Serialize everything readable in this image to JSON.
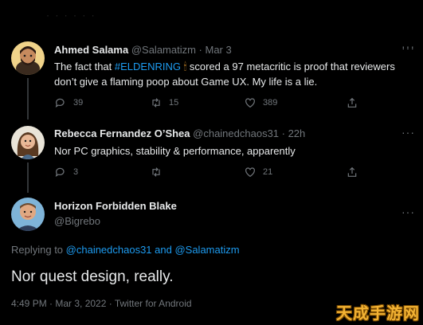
{
  "topbar": {
    "more_icon": "more-dots-icon"
  },
  "tweets": [
    {
      "name": "Ahmed Salama",
      "handle": "@Salamatizm · Mar 3",
      "text_before": "The fact that ",
      "hashtag": "#ELDENRING",
      "emoji": "🕯",
      "text_after": " scored a 97 metacritic is proof that reviewers don’t give a flaming poop about Game UX. My life is a lie.",
      "replies": "39",
      "retweets": "15",
      "likes": "389"
    },
    {
      "name": "Rebecca Fernandez O’Shea",
      "handle": "@chainedchaos31 · 22h",
      "text": "Nor PC graphics, stability & performance, apparently",
      "replies": "3",
      "retweets": "",
      "likes": "21"
    }
  ],
  "main": {
    "name": "Horizon Forbidden Blake",
    "handle": "@Bigrebo",
    "replying_prefix": "Replying to ",
    "mention_text": "@chainedchaos31 and @Salamatizm",
    "text": "Nor quest design, really.",
    "meta": "4:49 PM · Mar 3, 2022 · Twitter for Android"
  },
  "watermark": "天成手游网",
  "colors": {
    "background": "#000000",
    "accent": "#1d9bf0",
    "muted": "#71767b",
    "text": "#e7e9ea"
  }
}
